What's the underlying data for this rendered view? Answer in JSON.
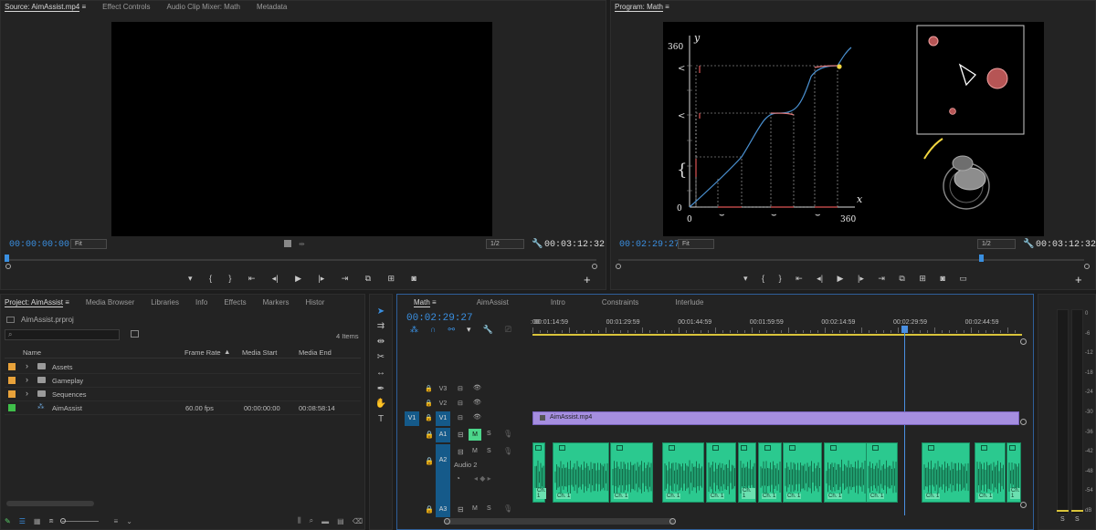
{
  "source": {
    "tabs": [
      "Source: AimAssist.mp4",
      "Effect Controls",
      "Audio Clip Mixer: Math",
      "Metadata"
    ],
    "timecode": "00:00:00:00",
    "fit": "Fit",
    "resolution": "1/2",
    "duration": "00:03:12:32"
  },
  "program": {
    "tab": "Program: Math",
    "timecode": "00:02:29:27",
    "fit": "Fit",
    "resolution": "1/2",
    "duration": "00:03:12:32",
    "graph": {
      "y_label": "y",
      "x_label": "x",
      "y_max": "360",
      "x_max": "360",
      "origin": "0",
      "x_zero": "0"
    }
  },
  "project": {
    "tabs": [
      "Project: AimAssist",
      "Media Browser",
      "Libraries",
      "Info",
      "Effects",
      "Markers",
      "Histor"
    ],
    "file": "AimAssist.prproj",
    "items_count": "4 Items",
    "columns": [
      "Name",
      "Frame Rate",
      "Media Start",
      "Media End"
    ],
    "rows": [
      {
        "name": "Assets",
        "color": "#e8a23a",
        "rate": "",
        "start": "",
        "end": ""
      },
      {
        "name": "Gameplay",
        "color": "#e8a23a",
        "rate": "",
        "start": "",
        "end": ""
      },
      {
        "name": "Sequences",
        "color": "#e8a23a",
        "rate": "",
        "start": "",
        "end": ""
      },
      {
        "name": "AimAssist",
        "color": "#3fbf4a",
        "rate": "60.00 fps",
        "start": "00:00:00:00",
        "end": "00:08:58:14"
      }
    ]
  },
  "timeline": {
    "tabs": [
      "Math",
      "AimAssist",
      "Intro",
      "Constraints",
      "Interlude"
    ],
    "timecode": "00:02:29:27",
    "ruler": [
      "00:01:14:59",
      "00:01:29:59",
      "00:01:44:59",
      "00:01:59:59",
      "00:02:14:59",
      "00:02:29:59",
      "00:02:44:59"
    ],
    "video_tracks": [
      "V3",
      "V2",
      "V1"
    ],
    "audio_tracks": [
      "A1",
      "A2",
      "A3"
    ],
    "source_v": "V1",
    "source_a": "A1",
    "audio2_name": "Audio 2",
    "video_clip": "AimAssist.mp4",
    "audio_clip_label": "Ch. 1",
    "m": "M",
    "s": "S"
  },
  "meter": {
    "labels": [
      "0",
      "-6",
      "-12",
      "-18",
      "-24",
      "-30",
      "-36",
      "-42",
      "-48",
      "-54",
      "dB"
    ],
    "s_left": "S",
    "s_right": "S"
  },
  "colors": {
    "accent": "#3a8fe0",
    "clip_video": "#a58ee0",
    "clip_audio": "#2bc98f",
    "playhead": "#4a90e2"
  }
}
